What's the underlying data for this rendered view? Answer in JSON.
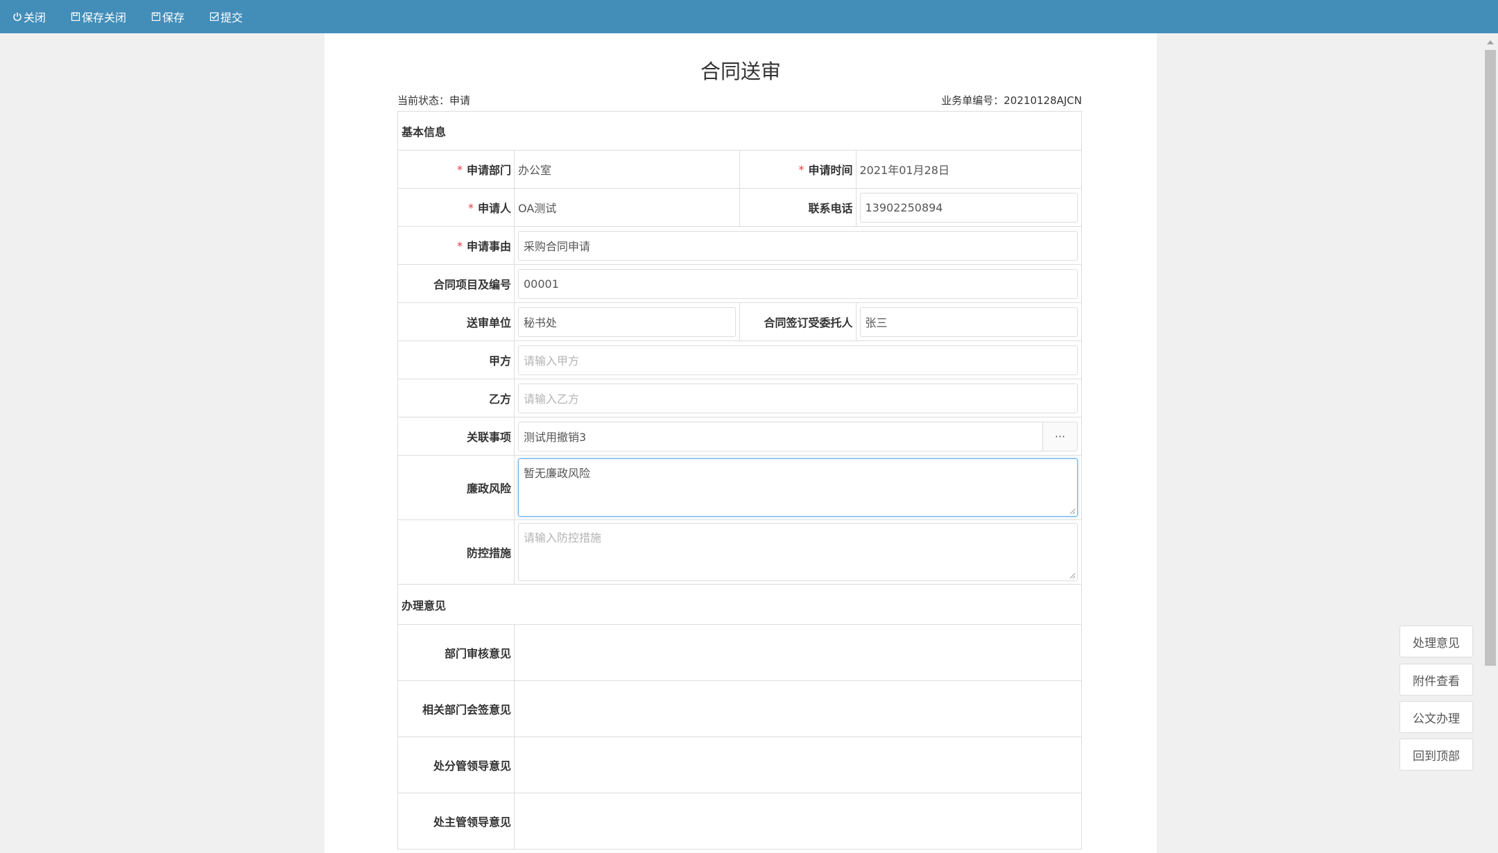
{
  "toolbar": {
    "close": "关闭",
    "save_close": "保存关闭",
    "save": "保存",
    "submit": "提交"
  },
  "form": {
    "title": "合同送审",
    "status_label": "当前状态：",
    "status_value": "申请",
    "doc_no_label": "业务单编号：",
    "doc_no_value": "20210128AJCN",
    "section_basic": "基本信息",
    "section_opinion": "办理意见",
    "fields": {
      "dept": {
        "label": "申请部门",
        "value": "办公室"
      },
      "apply_time": {
        "label": "申请时间",
        "value": "2021年01月28日"
      },
      "applicant": {
        "label": "申请人",
        "value": "OA测试"
      },
      "phone": {
        "label": "联系电话",
        "value": "13902250894"
      },
      "reason": {
        "label": "申请事由",
        "value": "采购合同申请"
      },
      "project": {
        "label": "合同项目及编号",
        "value": "00001"
      },
      "review_unit": {
        "label": "送审单位",
        "value": "秘书处"
      },
      "trustee": {
        "label": "合同签订受委托人",
        "value": "张三"
      },
      "party_a": {
        "label": "甲方",
        "placeholder": "请输入甲方"
      },
      "party_b": {
        "label": "乙方",
        "placeholder": "请输入乙方"
      },
      "related": {
        "label": "关联事项",
        "value": "测试用撤销3",
        "button": "···"
      },
      "risk": {
        "label": "廉政风险",
        "value": "暂无廉政风险"
      },
      "measures": {
        "label": "防控措施",
        "placeholder": "请输入防控措施"
      }
    },
    "opinions": [
      "部门审核意见",
      "相关部门会签意见",
      "处分管领导意见",
      "处主管领导意见"
    ]
  },
  "side_buttons": {
    "opinion": "处理意见",
    "attachments": "附件查看",
    "document": "公文办理",
    "back_top": "回到顶部"
  },
  "required_mark": "*",
  "colors": {
    "toolbar": "#438eb9",
    "required": "#e4393c",
    "focus": "#66afe9"
  }
}
